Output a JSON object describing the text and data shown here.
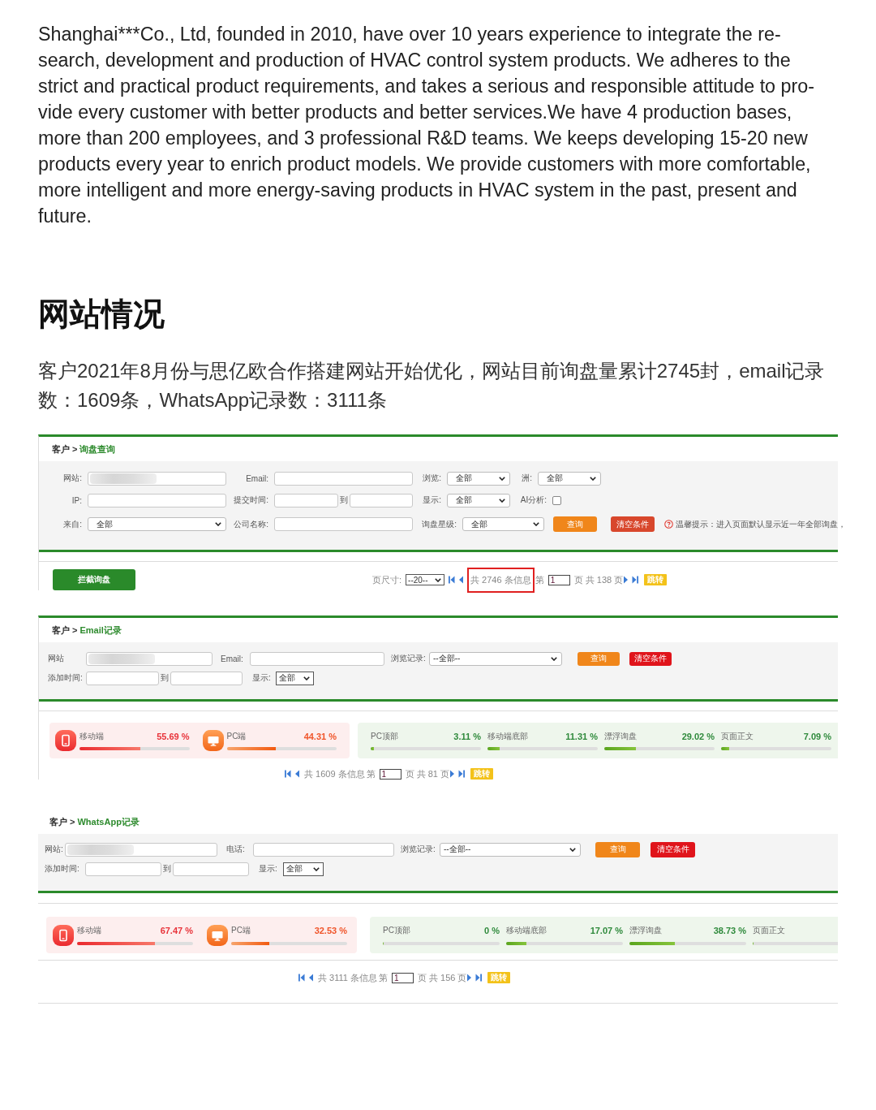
{
  "intro": "Shanghai***Co., Ltd, founded in 2010, have over 10 years experience to integrate the re-\nsearch, development and production of HVAC control system products. We adheres to the\nstrict and practical product requirements, and takes a serious and responsible attitude to pro-\nvide every customer with better products and better services.We have 4 production bases,\nmore than 200 employees, and 3 professional R&D teams. We keeps developing 15-20 new\nproducts every year to enrich product models. We provide customers with more comfortable,\nmore intelligent and more energy-saving products in HVAC system in the past, present and\nfuture.",
  "heading": "网站情况",
  "summary": "客户2021年8月份与思亿欧合作搭建网站开始优化，网站目前询盘量累计2745封，email记录数：1609条，WhatsApp记录数：3111条",
  "panels": [
    {
      "framed": true,
      "breadcrumb": {
        "root": "客户 >",
        "current": "询盘查询"
      },
      "filter_rows": [
        [
          {
            "kind": "input",
            "label": "网站:",
            "redacted": true
          },
          {
            "kind": "input",
            "label": "Email:",
            "redacted": false
          },
          {
            "kind": "select",
            "label": "浏览:",
            "value": "全部"
          },
          {
            "kind": "select",
            "label": "洲:",
            "value": "全部"
          }
        ],
        [
          {
            "kind": "input",
            "label": "IP:",
            "redacted": false
          },
          {
            "kind": "range",
            "label": "提交时间:",
            "separator": "到"
          },
          {
            "kind": "select",
            "label": "显示:",
            "value": "全部"
          },
          {
            "kind": "checkbox",
            "label": "AI分析:",
            "checked": false
          }
        ],
        [
          {
            "kind": "select",
            "label": "来自:",
            "value": "全部"
          },
          {
            "kind": "input",
            "label": "公司名称:",
            "redacted": false
          },
          {
            "kind": "select",
            "label": "询盘星级:",
            "value": "全部"
          },
          {
            "kind": "search",
            "label": "查询"
          },
          {
            "kind": "clear",
            "label": "清空条件"
          },
          {
            "kind": "tip",
            "label": "温馨提示：进入页面默认显示近一年全部询盘，"
          }
        ]
      ],
      "action_button": "拦截询盘",
      "pager": {
        "size_label": "页尺寸:",
        "size": "--20--",
        "total": "共 2746 条信息",
        "highlighted": true,
        "page_prefix": "第",
        "page": "1",
        "page_suffix": "页 共 138 页",
        "jump": "跳转"
      }
    },
    {
      "framed": true,
      "breadcrumb": {
        "root": "客户 >",
        "current": "Email记录"
      },
      "filter_rows": [
        [
          {
            "kind": "input",
            "label": "网站",
            "redacted": true
          },
          {
            "kind": "input",
            "label": "Email:",
            "redacted": false
          },
          {
            "kind": "select",
            "label": "浏览记录:",
            "value": "--全部--"
          },
          {
            "kind": "search",
            "label": "查询"
          },
          {
            "kind": "clear",
            "label": "清空条件"
          }
        ],
        [
          {
            "kind": "range",
            "label": "添加时间:",
            "separator": "到"
          },
          {
            "kind": "select",
            "label": "显示:",
            "value": "全部"
          }
        ]
      ],
      "stats": {
        "devices": [
          {
            "kind": "mobile",
            "label": "移动端",
            "value": "55.69 %",
            "level": 0.5569
          },
          {
            "kind": "pc",
            "label": "PC端",
            "value": "44.31 %",
            "level": 0.4431
          }
        ],
        "placements": [
          {
            "label": "PC顶部",
            "value": "3.11 %",
            "level": 0.0311
          },
          {
            "label": "移动端底部",
            "value": "11.31 %",
            "level": 0.1131
          },
          {
            "label": "漂浮询盘",
            "value": "29.02 %",
            "level": 0.2902
          },
          {
            "label": "页面正文",
            "value": "7.09 %",
            "level": 0.0709
          }
        ]
      },
      "pager": {
        "total": "共 1609 条信息",
        "highlighted": false,
        "page_prefix": "第",
        "page": "1",
        "page_suffix": "页 共 81 页",
        "jump": "跳转"
      }
    },
    {
      "framed": false,
      "breadcrumb": {
        "root": "客户 >",
        "current": "WhatsApp记录"
      },
      "filter_rows": [
        [
          {
            "kind": "input",
            "label": "网站:",
            "redacted": true
          },
          {
            "kind": "input",
            "label": "电话:",
            "redacted": false
          },
          {
            "kind": "select",
            "label": "浏览记录:",
            "value": "--全部--"
          },
          {
            "kind": "search",
            "label": "查询"
          },
          {
            "kind": "clear",
            "label": "清空条件"
          }
        ],
        [
          {
            "kind": "range",
            "label": "添加时间:",
            "separator": "到"
          },
          {
            "kind": "select",
            "label": "显示:",
            "value": "全部"
          }
        ]
      ],
      "stats": {
        "devices": [
          {
            "kind": "mobile",
            "label": "移动端",
            "value": "67.47 %",
            "level": 0.6747
          },
          {
            "kind": "pc",
            "label": "PC端",
            "value": "32.53 %",
            "level": 0.3253
          }
        ],
        "placements": [
          {
            "label": "PC顶部",
            "value": "0 %",
            "level": 0
          },
          {
            "label": "移动端底部",
            "value": "17.07 %",
            "level": 0.1707
          },
          {
            "label": "漂浮询盘",
            "value": "38.73 %",
            "level": 0.3873
          },
          {
            "label": "页面正文",
            "level": 0
          }
        ]
      },
      "pager": {
        "total": "共 3111 条信息",
        "highlighted": false,
        "page_prefix": "第",
        "page": "1",
        "page_suffix": "页 共 156 页",
        "jump": "跳转"
      }
    }
  ]
}
